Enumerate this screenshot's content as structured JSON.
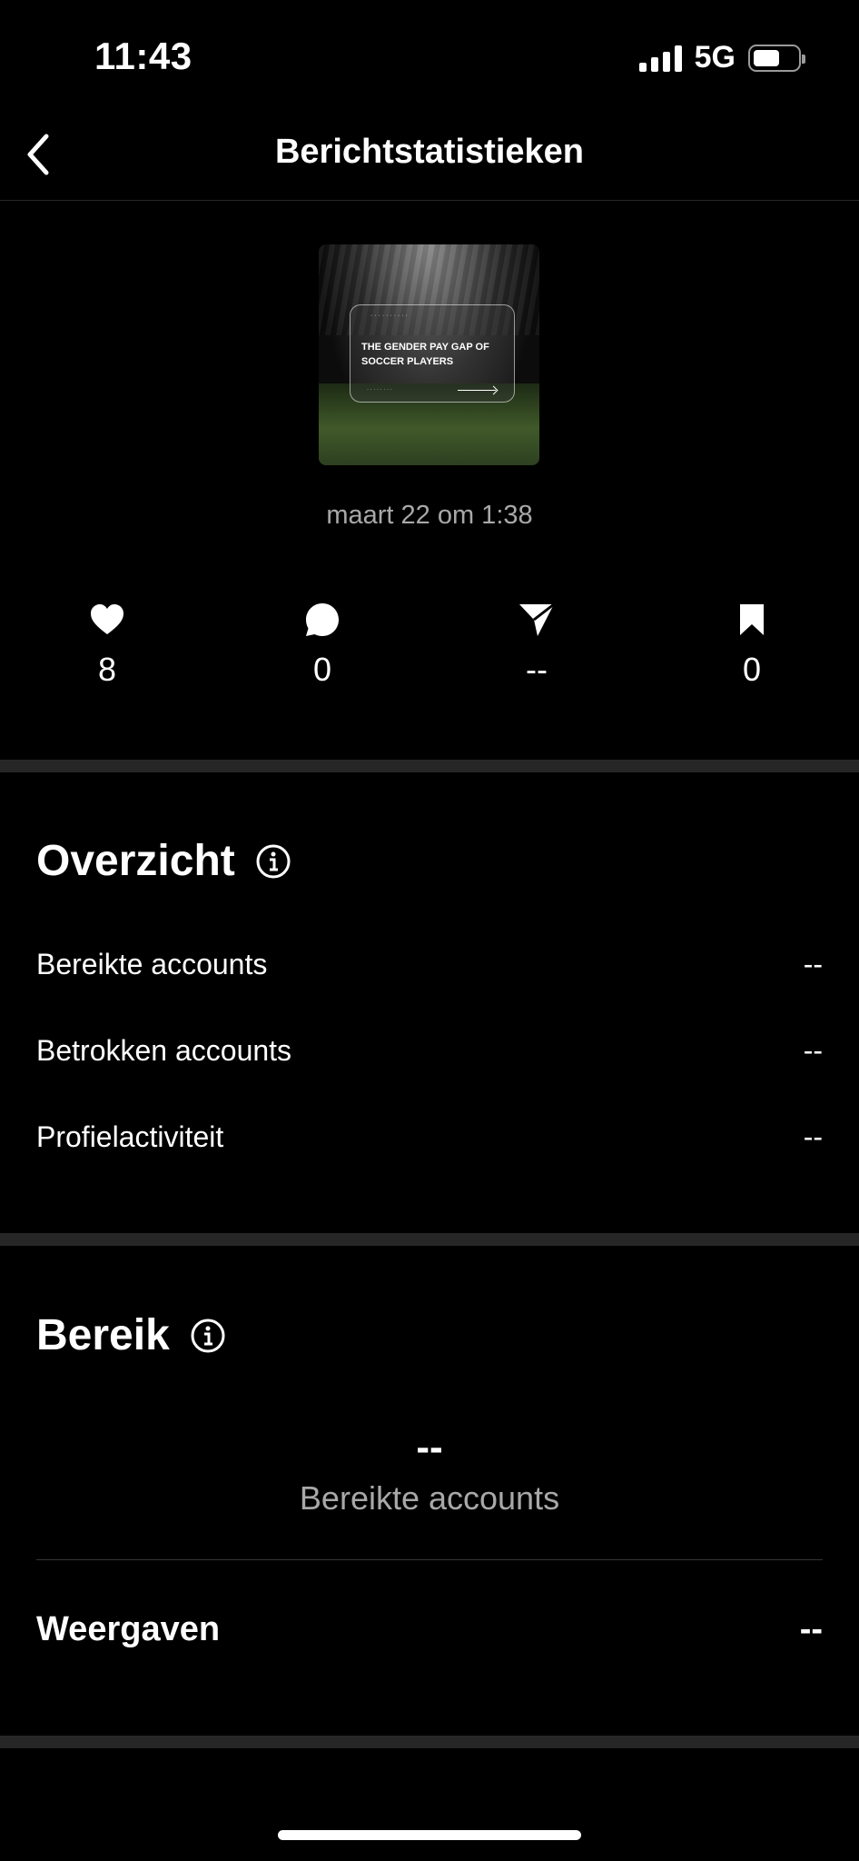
{
  "status_bar": {
    "time": "11:43",
    "network": "5G"
  },
  "nav": {
    "title": "Berichtstatistieken"
  },
  "post": {
    "thumbnail_title": "THE GENDER PAY GAP OF SOCCER PLAYERS",
    "date": "maart 22 om 1:38"
  },
  "engagement": {
    "likes": "8",
    "comments": "0",
    "shares": "--",
    "saves": "0"
  },
  "overview": {
    "title": "Overzicht",
    "rows": [
      {
        "label": "Bereikte accounts",
        "value": "--"
      },
      {
        "label": "Betrokken accounts",
        "value": "--"
      },
      {
        "label": "Profielactiviteit",
        "value": "--"
      }
    ]
  },
  "reach": {
    "title": "Bereik",
    "value": "--",
    "label": "Bereikte accounts",
    "views_label": "Weergaven",
    "views_value": "--"
  },
  "icons": [
    "back-chevron-icon",
    "heart-icon",
    "comment-icon",
    "share-icon",
    "bookmark-icon",
    "info-icon"
  ]
}
